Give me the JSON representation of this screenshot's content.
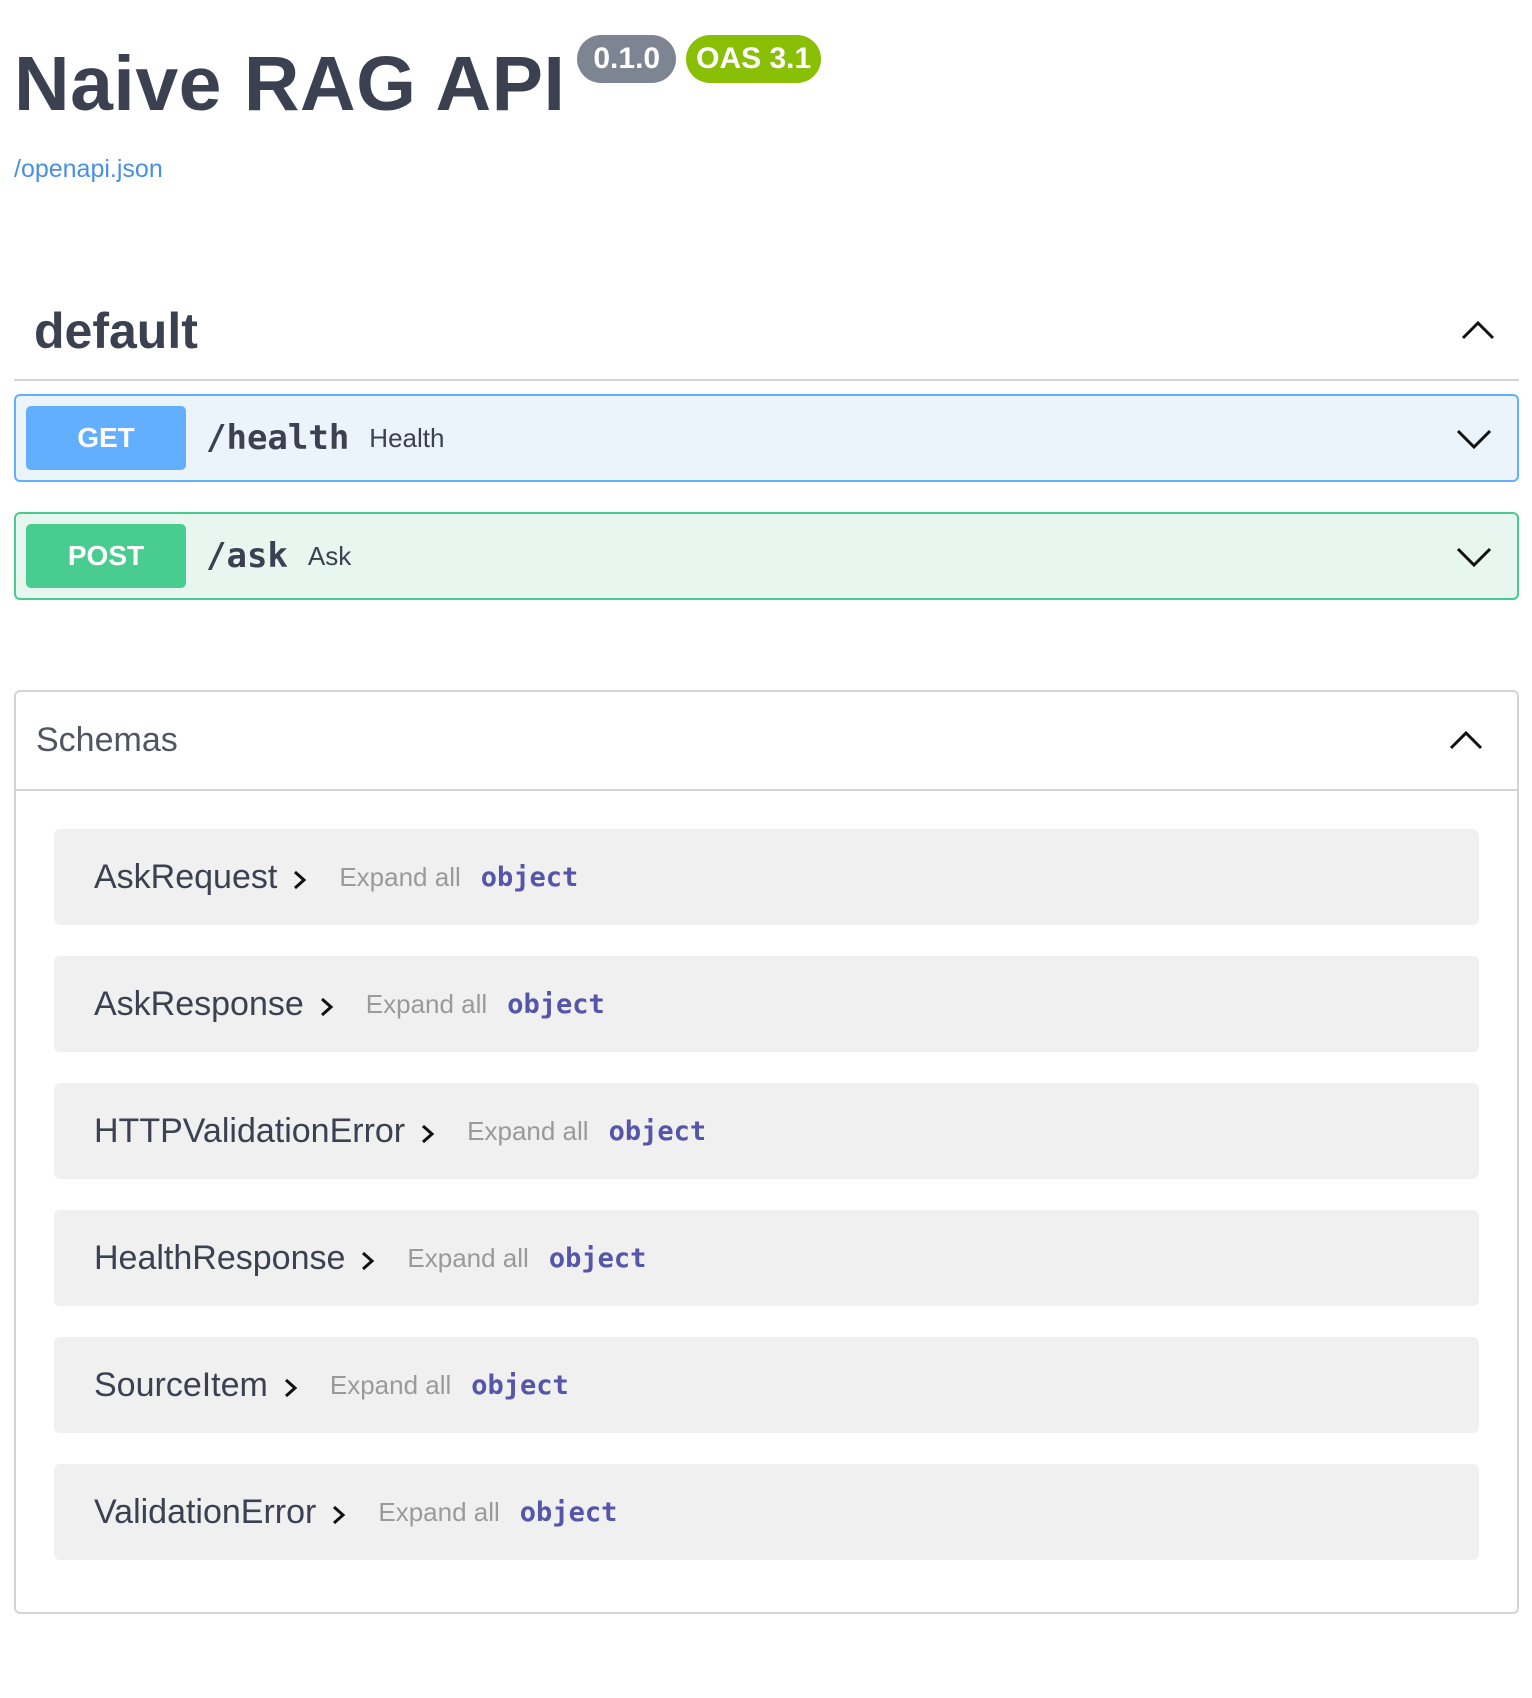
{
  "info": {
    "title": "Naive RAG API",
    "version": "0.1.0",
    "oas_version": "OAS 3.1",
    "spec_link": "/openapi.json"
  },
  "tag": {
    "name": "default",
    "toggle_icon": "chevron-up-icon"
  },
  "operations": [
    {
      "method": "GET",
      "path": "/health",
      "summary": "Health",
      "color": "#61affe",
      "toggle_icon": "chevron-down-icon"
    },
    {
      "method": "POST",
      "path": "/ask",
      "summary": "Ask",
      "color": "#49cc90",
      "toggle_icon": "chevron-down-icon"
    }
  ],
  "schemas": {
    "title": "Schemas",
    "toggle_icon": "chevron-up-icon",
    "expand_all_label": "Expand all",
    "items": [
      {
        "name": "AskRequest",
        "type": "object"
      },
      {
        "name": "AskResponse",
        "type": "object"
      },
      {
        "name": "HTTPValidationError",
        "type": "object"
      },
      {
        "name": "HealthResponse",
        "type": "object"
      },
      {
        "name": "SourceItem",
        "type": "object"
      },
      {
        "name": "ValidationError",
        "type": "object"
      }
    ]
  },
  "colors": {
    "get": "#61affe",
    "post": "#49cc90",
    "version_badge": "#7d8492",
    "oas_badge": "#89bf04",
    "link": "#4990e2"
  }
}
